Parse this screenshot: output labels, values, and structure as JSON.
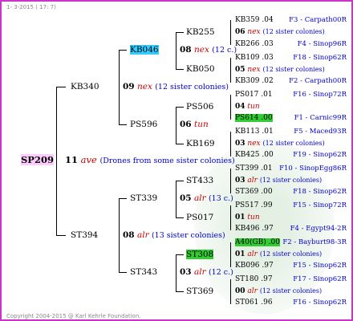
{
  "header": "1-  3-2015 ( 17: 7)",
  "footer": "Copyright 2004-2015 @ Karl Kehrle Foundation.",
  "root": {
    "id": "SP209",
    "year": "11",
    "subspecies": "ave",
    "note": "(Drones from some sister colonies)"
  },
  "gen2": [
    {
      "id": "KB340",
      "year": "09",
      "subspecies": "nex",
      "note": "(12 sister colonies)"
    },
    {
      "id": "ST394",
      "year": "08",
      "subspecies": "alr",
      "note": "(13 sister colonies)"
    }
  ],
  "gen3": [
    {
      "id": "KB046",
      "year": "08",
      "subspecies": "nex",
      "note": "(12 c.)"
    },
    {
      "id": "PS596",
      "year": "06",
      "subspecies": "tun",
      "note": ""
    },
    {
      "id": "ST339",
      "year": "05",
      "subspecies": "alr",
      "note": "(13 c.)"
    },
    {
      "id": "ST343",
      "year": "03",
      "subspecies": "alr",
      "note": "(12 c.)"
    }
  ],
  "gen4": [
    "KB255",
    "KB050",
    "PS506",
    "KB169",
    "ST433",
    "PS017",
    "ST308",
    "ST369"
  ],
  "gen5": [
    {
      "id": "KB359",
      "year": ".04",
      "origin": "F3 - Carpath00R"
    },
    {
      "id": "06",
      "subspecies": "nex",
      "note": "(12 sister colonies)"
    },
    {
      "id": "KB266",
      "year": ".03",
      "origin": "F4 - Sinop96R"
    },
    {
      "id": "KB109",
      "year": ".03",
      "origin": "F18 - Sinop62R"
    },
    {
      "id": "05",
      "subspecies": "nex",
      "note": "(12 sister colonies)"
    },
    {
      "id": "KB309",
      "year": ".02",
      "origin": "F2 - Carpath00R"
    },
    {
      "id": "PS017",
      "year": ".01",
      "origin": "F16 - Sinop72R"
    },
    {
      "id": "04",
      "subspecies": "tun",
      "note": ""
    },
    {
      "id": "PS614",
      "year": ".00",
      "origin": "F1 - Carnic99R"
    },
    {
      "id": "KB113",
      "year": ".01",
      "origin": "F5 - Maced93R"
    },
    {
      "id": "03",
      "subspecies": "nex",
      "note": "(12 sister colonies)"
    },
    {
      "id": "KB425",
      "year": ".00",
      "origin": "F19 - Sinop62R"
    },
    {
      "id": "ST399",
      "year": ".01",
      "origin": "F10 - SinopEgg86R"
    },
    {
      "id": "03",
      "subspecies": "alr",
      "note": "(12 sister colonies)"
    },
    {
      "id": "ST369",
      "year": ".00",
      "origin": "F18 - Sinop62R"
    },
    {
      "id": "PS517",
      "year": ".99",
      "origin": "F15 - Sinop72R"
    },
    {
      "id": "01",
      "subspecies": "tun",
      "note": ""
    },
    {
      "id": "KB496",
      "year": ".97",
      "origin": "F4 - Egypt94-2R"
    },
    {
      "id": "A40(GB)",
      "year": ".00",
      "origin": "F2 - Bayburt98-3R"
    },
    {
      "id": "01",
      "subspecies": "alr",
      "note": "(12 sister colonies)"
    },
    {
      "id": "KB096",
      "year": ".97",
      "origin": "F15 - Sinop62R"
    },
    {
      "id": "ST180",
      "year": ".97",
      "origin": "F17 - Sinop62R"
    },
    {
      "id": "00",
      "subspecies": "alr",
      "note": "(12 sister colonies)"
    },
    {
      "id": "ST061",
      "year": ".96",
      "origin": "F16 - Sinop62R"
    }
  ]
}
